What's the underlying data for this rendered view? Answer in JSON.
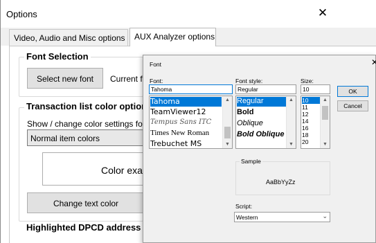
{
  "window": {
    "title": "Options",
    "close_glyph": "✕"
  },
  "tabs": [
    {
      "label": "Video, Audio and Misc options",
      "active": false
    },
    {
      "label": "AUX Analyzer options",
      "active": true
    }
  ],
  "font_selection": {
    "group_label": "Font Selection",
    "select_button": "Select new font",
    "current_font_label": "Current fi"
  },
  "transaction_colors": {
    "group_label": "Transaction list color optior",
    "description": "Show / change color settings for",
    "dropdown_value": "Normal item colors",
    "color_example": "Color exan",
    "change_text_button": "Change text color"
  },
  "highlighted_group_label": "Highlighted DPCD address r",
  "font_dialog": {
    "title": "Font",
    "close_glyph": "✕",
    "font_label": "Font:",
    "font_value": "Tahoma",
    "fonts": [
      "Tahoma",
      "TeamViewer12",
      "Tempus Sans ITC",
      "Times New Roman",
      "Trebuchet MS"
    ],
    "style_label": "Font style:",
    "style_value": "Regular",
    "styles": [
      "Regular",
      "Bold",
      "Oblique",
      "Bold Oblique"
    ],
    "size_label": "Size:",
    "size_value": "10",
    "sizes": [
      "10",
      "11",
      "12",
      "14",
      "16",
      "18",
      "20"
    ],
    "ok_button": "OK",
    "cancel_button": "Cancel",
    "sample_label": "Sample",
    "sample_text": "AaBbYyZz",
    "script_label": "Script:",
    "script_value": "Western"
  },
  "colors": {
    "accent": "#0078d7",
    "dialog_bg": "#f0f0f0"
  }
}
